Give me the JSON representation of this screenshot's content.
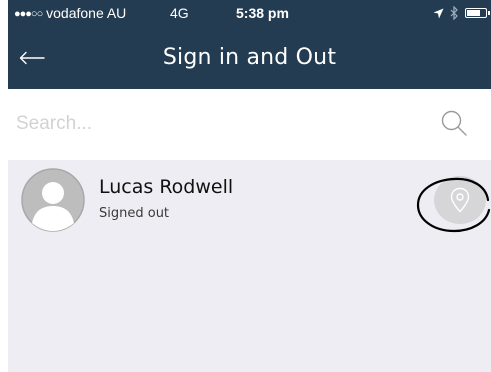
{
  "status_bar": {
    "signal": "●●●○○",
    "carrier": "vodafone AU",
    "network": "4G",
    "time": "5:38 pm"
  },
  "nav": {
    "title": "Sign in and Out",
    "back_icon": "arrow-left-icon"
  },
  "search": {
    "placeholder": "Search...",
    "value": "",
    "icon": "search-icon"
  },
  "list": {
    "items": [
      {
        "name": "Lucas Rodwell",
        "status": "Signed out",
        "avatar_icon": "person-silhouette-icon",
        "action_icon": "location-pin-icon"
      }
    ]
  },
  "colors": {
    "header_bg": "#243c52",
    "list_bg": "#eeedf3",
    "placeholder": "#d2d2d2",
    "avatar_bg": "#bdbdbd",
    "action_bg": "#d6d6d9"
  }
}
